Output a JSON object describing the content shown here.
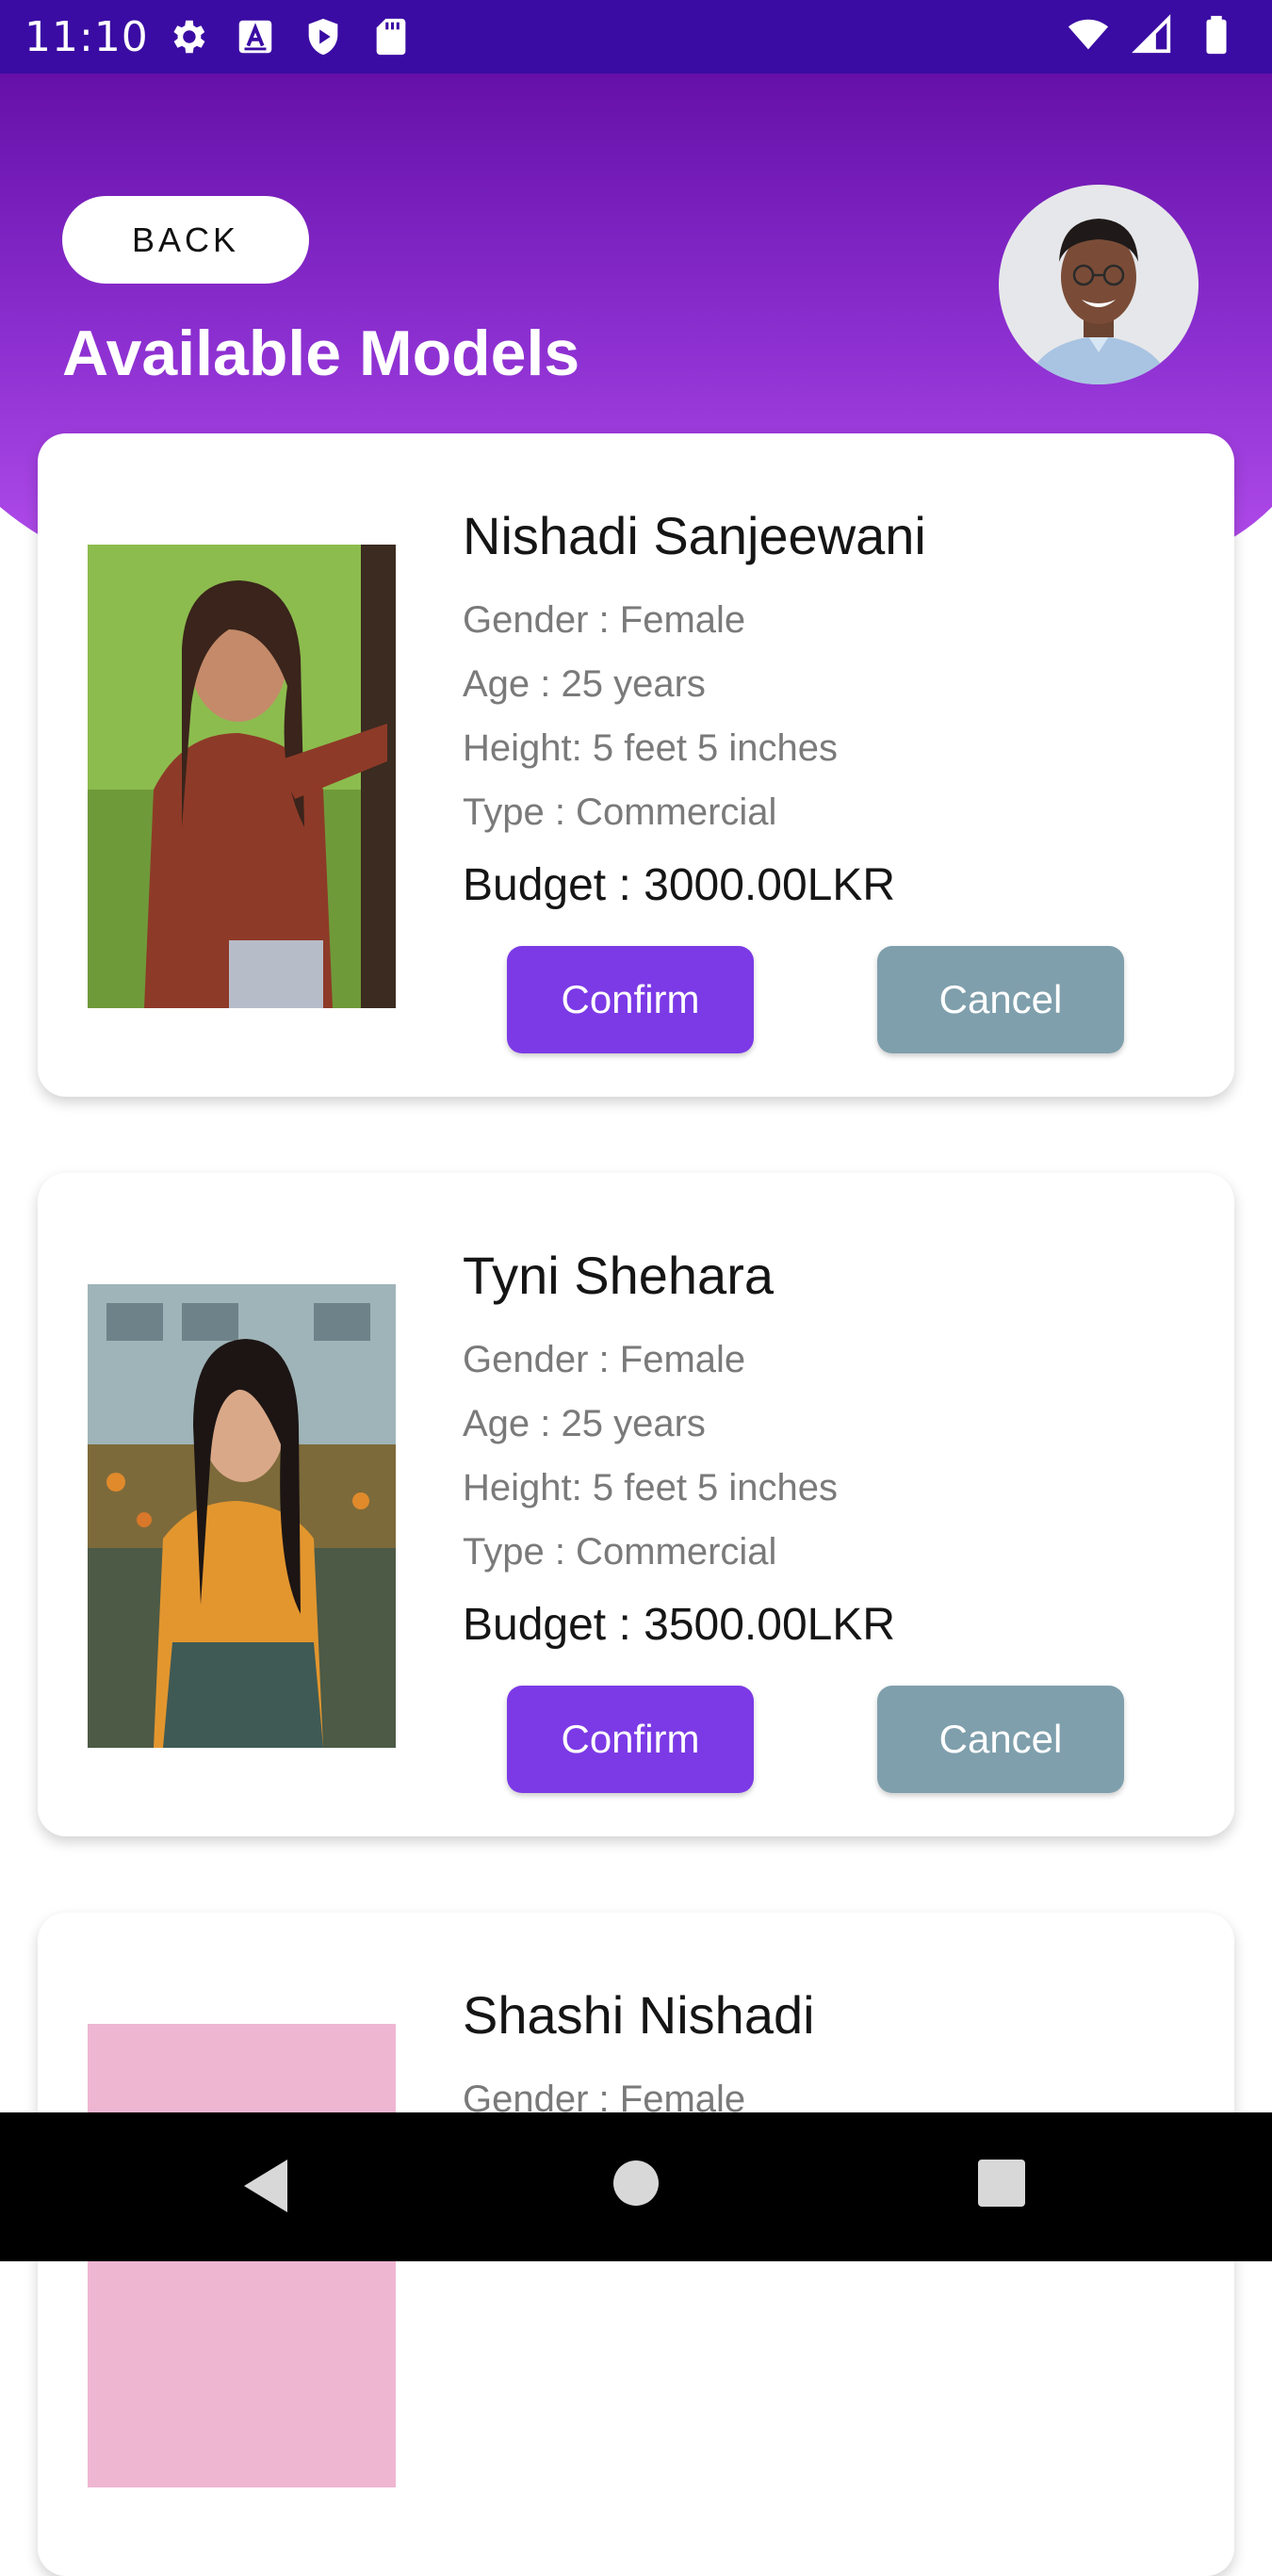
{
  "status_bar": {
    "time": "11:10",
    "left_icons": [
      "settings-icon",
      "a-box-icon",
      "shield-play-icon",
      "sd-card-icon"
    ],
    "right_icons": [
      "wifi-icon",
      "signal-icon",
      "battery-icon"
    ]
  },
  "header": {
    "back_label": "BACK",
    "title": "Available Models"
  },
  "models": [
    {
      "name": "Nishadi Sanjeewani",
      "gender": "Gender : Female",
      "age": "Age : 25 years",
      "height": "Height: 5 feet 5 inches",
      "type": "Type : Commercial",
      "budget": "Budget : 3000.00LKR",
      "confirm_label": "Confirm",
      "cancel_label": "Cancel"
    },
    {
      "name": "Tyni Shehara",
      "gender": "Gender : Female",
      "age": "Age : 25 years",
      "height": "Height: 5 feet 5 inches",
      "type": "Type : Commercial",
      "budget": "Budget : 3500.00LKR",
      "confirm_label": "Confirm",
      "cancel_label": "Cancel"
    },
    {
      "name": "Shashi Nishadi",
      "gender": "Gender : Female"
    }
  ],
  "nav_bar": {
    "icons": [
      "back-triangle-icon",
      "home-circle-icon",
      "recents-square-icon"
    ]
  },
  "colors": {
    "status_bar": "#3a0ca3",
    "header_top": "#6510a8",
    "header_bottom": "#b04bea",
    "confirm": "#7c3ae6",
    "cancel": "#7f9fac"
  }
}
